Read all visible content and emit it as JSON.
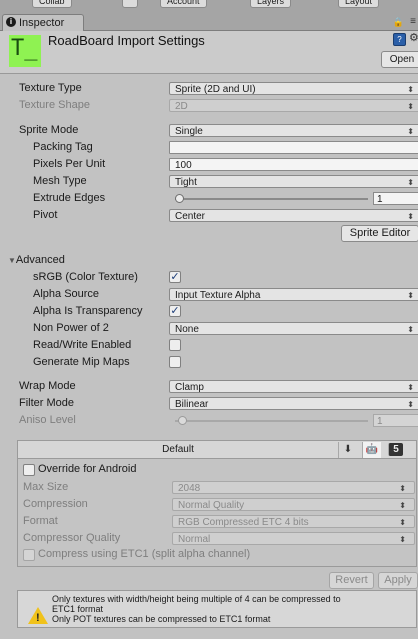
{
  "toolbar": {
    "collab_label": "Collab",
    "account_label": "Account",
    "layers_label": "Layers",
    "layout_label": "Layout"
  },
  "tab": {
    "icon_glyph": "i",
    "label": "Inspector",
    "lock_glyph": "🔒",
    "menu_glyph": "≡"
  },
  "header": {
    "asset_icon_glyph": "T_",
    "title": "RoadBoard Import Settings",
    "open_label": "Open",
    "help_glyph": "?",
    "settings_glyph": "⚙"
  },
  "texture": {
    "type_label": "Texture Type",
    "type_value": "Sprite (2D and UI)",
    "shape_label": "Texture Shape",
    "shape_value": "2D",
    "sprite_mode_label": "Sprite Mode",
    "sprite_mode_value": "Single",
    "packing_tag_label": "Packing Tag",
    "packing_tag_value": "",
    "ppu_label": "Pixels Per Unit",
    "ppu_value": "100",
    "mesh_type_label": "Mesh Type",
    "mesh_type_value": "Tight",
    "extrude_label": "Extrude Edges",
    "extrude_value": "1",
    "extrude_fraction": 0.02,
    "pivot_label": "Pivot",
    "pivot_value": "Center",
    "sprite_editor_label": "Sprite Editor"
  },
  "advanced": {
    "foldout_label": "Advanced",
    "srgb_label": "sRGB (Color Texture)",
    "srgb_checked": true,
    "alpha_source_label": "Alpha Source",
    "alpha_source_value": "Input Texture Alpha",
    "alpha_transparency_label": "Alpha Is Transparency",
    "alpha_transparency_checked": true,
    "npot_label": "Non Power of 2",
    "npot_value": "None",
    "readwrite_label": "Read/Write Enabled",
    "readwrite_checked": false,
    "mipmaps_label": "Generate Mip Maps",
    "mipmaps_checked": false
  },
  "wrap": {
    "wrap_label": "Wrap Mode",
    "wrap_value": "Clamp",
    "filter_label": "Filter Mode",
    "filter_value": "Bilinear",
    "aniso_label": "Aniso Level",
    "aniso_value": "1"
  },
  "platform": {
    "default_label": "Default",
    "override_label": "Override for Android",
    "override_checked": false,
    "max_size_label": "Max Size",
    "max_size_value": "2048",
    "compression_label": "Compression",
    "compression_value": "Normal Quality",
    "format_label": "Format",
    "format_value": "RGB Compressed ETC 4 bits",
    "compressor_label": "Compressor Quality",
    "compressor_value": "Normal",
    "etc1_label": "Compress using ETC1 (split alpha channel)",
    "icon_standalone": "⬇",
    "icon_android": "🤖",
    "icon_html5": "5"
  },
  "actions": {
    "revert_label": "Revert",
    "apply_label": "Apply"
  },
  "help": {
    "line1": "Only textures with width/height being multiple of 4 can be compressed to",
    "line2": "ETC1 format",
    "line3": "Only POT textures can be compressed to ETC1 format"
  },
  "colors": {
    "asset_icon_bg": "#8ff252",
    "check": "#1c3d78",
    "warning": "#f0c21b"
  }
}
